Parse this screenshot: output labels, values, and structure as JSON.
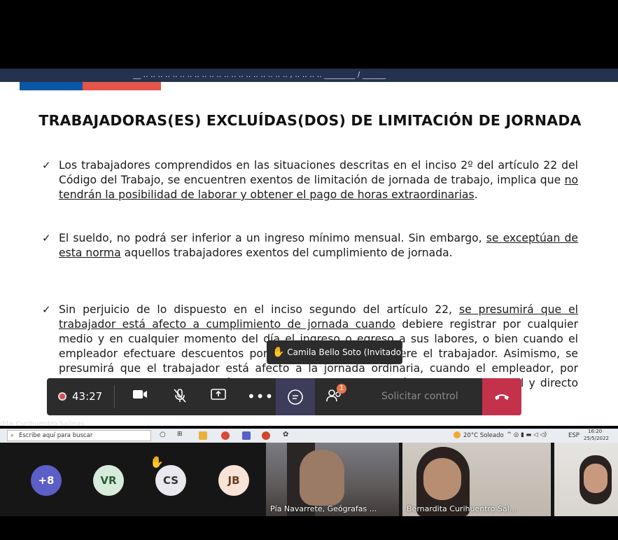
{
  "slide": {
    "topbar_text": "__ .. .. .. .. .. .. .. .. .. .. .. .. .. .. .. .. .. .. .. .. , .. .. .. .. ________ / ______",
    "title": "TRABAJADORAS(ES) EXCLUÍDAS(DOS) DE LIMITACIÓN DE JORNADA",
    "bullet1": {
      "a": "Los trabajadores comprendidos en las situaciones descritas en el inciso 2º del artículo 22 del Código del Trabajo, se encuentren exentos de limitación de jornada de trabajo, implica que ",
      "b": "no tendrán la posibilidad de laborar y obtener el pago de horas extraordinarias",
      "c": "."
    },
    "bullet2": {
      "a": "El sueldo, no podrá ser inferior a un ingreso mínimo mensual. Sin embargo, ",
      "b": "se exceptúan de esta norma",
      "c": " aquellos trabajadores exentos del cumplimiento de jornada."
    },
    "bullet3": {
      "a": "Sin perjuicio de lo dispuesto en el inciso segundo del artículo 22, ",
      "b": "se presumirá que el trabajador está afecto a cumplimiento de jornada cuando",
      "c": " debiere registrar por cualquier medio y en cualquier momento del día el ingreso o egreso a sus labores, o bien cuando el empleador efectuare descuentos por atrasos en que incurriere el trabajador. Asimismo, se presumirá que el trabajador está afecto a la jornada ordinaria, cuando el empleador, por intermedio de un superior jerárquico, ejerciere una supervisión o control funcional y directo sobre la forma y oportunidad en que se desarrollen las labores."
    }
  },
  "toolbar": {
    "timer": "43:27",
    "share_control": "Solicitar control",
    "participants_badge": "1"
  },
  "tooltip": {
    "text": "Camila Bello Soto (Invitado)"
  },
  "presenter_name": "dita Curihuentro Salinas",
  "taskbar": {
    "search_placeholder": "Escribe aquí para buscar",
    "weather": "20°C Soleado",
    "lang": "ESP",
    "time": "16:20",
    "date": "25/5/2022"
  },
  "participants": {
    "overflow": "+8",
    "avatars": [
      {
        "initials": "VR",
        "bg": "#d6ebd9",
        "fg": "#2e5a3a"
      },
      {
        "initials": "CS",
        "bg": "#e8e8ee",
        "fg": "#333"
      },
      {
        "initials": "JB",
        "bg": "#f7e4d6",
        "fg": "#6b3e22"
      }
    ],
    "tiles": [
      {
        "name": "Pía Navarrete, Geógrafas ..."
      },
      {
        "name": "Bernardita Curihuentro Sal..."
      }
    ]
  },
  "colors": {
    "accent_purple": "#5b5fc7",
    "hangup_red": "#c4314b",
    "flag_blue": "#0b57a4",
    "flag_red": "#e4554b"
  }
}
